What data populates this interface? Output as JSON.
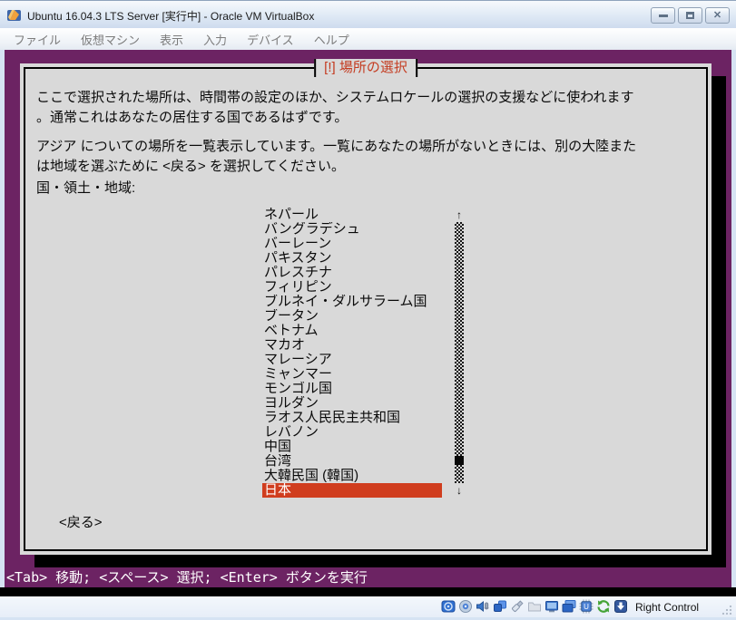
{
  "window": {
    "title": "Ubuntu 16.04.3 LTS Server [実行中] - Oracle VM VirtualBox",
    "controls": [
      "minimize",
      "restore",
      "close"
    ]
  },
  "menu_bar": {
    "items": [
      "ファイル",
      "仮想マシン",
      "表示",
      "入力",
      "デバイス",
      "ヘルプ"
    ]
  },
  "installer": {
    "dialog_title": "[!] 場所の選択",
    "intro_line1": "ここで選択された場所は、時間帯の設定のほか、システムロケールの選択の支援などに使われます",
    "intro_line2": "。通常これはあなたの居住する国であるはずです。",
    "hint_line1": "アジア についての場所を一覧表示しています。一覧にあなたの場所がないときには、別の大陸また",
    "hint_line2": "は地域を選ぶために <戻る> を選択してください。",
    "list_label": "国・領土・地域:",
    "countries": [
      "ネパール",
      "バングラデシュ",
      "バーレーン",
      "パキスタン",
      "パレスチナ",
      "フィリピン",
      "ブルネイ・ダルサラーム国",
      "ブータン",
      "ベトナム",
      "マカオ",
      "マレーシア",
      "ミャンマー",
      "モンゴル国",
      "ヨルダン",
      "ラオス人民民主共和国",
      "レバノン",
      "中国",
      "台湾",
      "大韓民国 (韓国)",
      "日本"
    ],
    "selected_country": "日本",
    "back_button": "<戻る>",
    "scroll_up_arrow": "↑",
    "scroll_down_arrow": "↓",
    "help_line": "<Tab> 移動; <スペース> 選択; <Enter> ボタンを実行",
    "colors": {
      "background": "#6C2363",
      "dialog": "#D9D9D9",
      "title_text": "#C43B20",
      "selection_background": "#D03D1E",
      "selection_text": "#FFFFFF"
    }
  },
  "status_bar": {
    "icons": [
      "hard-disks",
      "optical-drives",
      "audio",
      "network",
      "usb-devices",
      "shared-folders",
      "display",
      "recording",
      "cpu-features",
      "mouse-integration",
      "keyboard-capture"
    ],
    "host_key_label": "Right Control"
  }
}
